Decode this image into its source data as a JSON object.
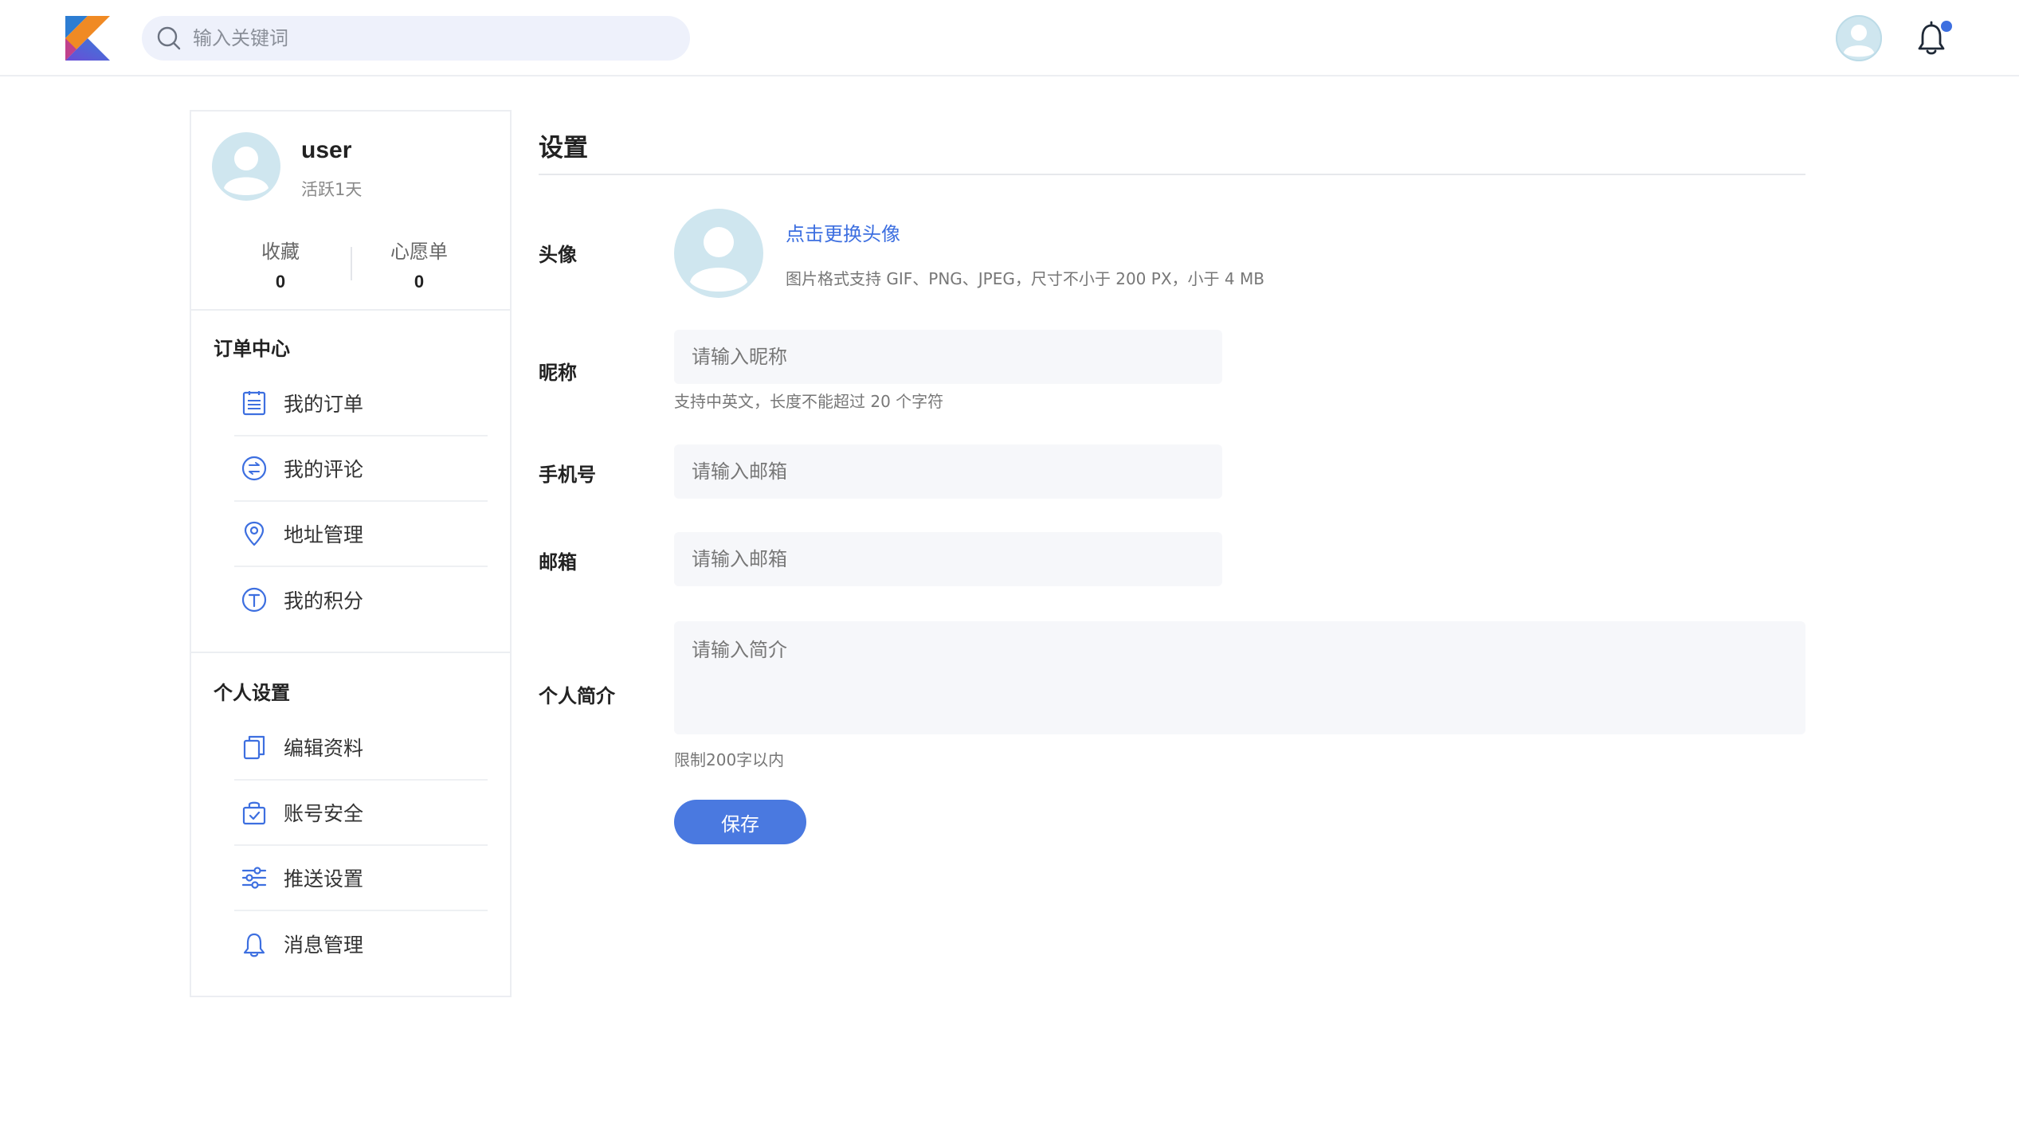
{
  "header": {
    "logo": "kotlin-logo",
    "search_placeholder": "输入关键词"
  },
  "profile": {
    "username": "user",
    "active_text": "活跃1天",
    "stats": [
      {
        "label": "收藏",
        "value": "0"
      },
      {
        "label": "心愿单",
        "value": "0"
      }
    ]
  },
  "sidebar": {
    "orders": {
      "title": "订单中心",
      "items": [
        {
          "label": "我的订单",
          "icon": "list-icon"
        },
        {
          "label": "我的评论",
          "icon": "comment-icon"
        },
        {
          "label": "地址管理",
          "icon": "location-icon"
        },
        {
          "label": "我的积分",
          "icon": "points-icon"
        }
      ]
    },
    "personal": {
      "title": "个人设置",
      "items": [
        {
          "label": "编辑资料",
          "icon": "documents-icon"
        },
        {
          "label": "账号安全",
          "icon": "security-bag-icon"
        },
        {
          "label": "推送设置",
          "icon": "sliders-icon"
        },
        {
          "label": "消息管理",
          "icon": "bell-icon"
        }
      ]
    }
  },
  "settings": {
    "title": "设置",
    "avatar": {
      "label": "头像",
      "change_link": "点击更换头像",
      "hint": "图片格式支持 GIF、PNG、JPEG，尺寸不小于 200 PX，小于 4 MB"
    },
    "nickname": {
      "label": "昵称",
      "placeholder": "请输入昵称",
      "hint": "支持中英文，长度不能超过 20 个字符"
    },
    "phone": {
      "label": "手机号",
      "placeholder": "请输入邮箱"
    },
    "email": {
      "label": "邮箱",
      "placeholder": "请输入邮箱"
    },
    "bio": {
      "label": "个人简介",
      "placeholder": "请输入简介",
      "hint": "限制200字以内"
    },
    "save_label": "保存"
  },
  "colors": {
    "accent": "#3d6fe0",
    "button": "#4a79e0",
    "avatar_bg": "#cfe6ef"
  }
}
